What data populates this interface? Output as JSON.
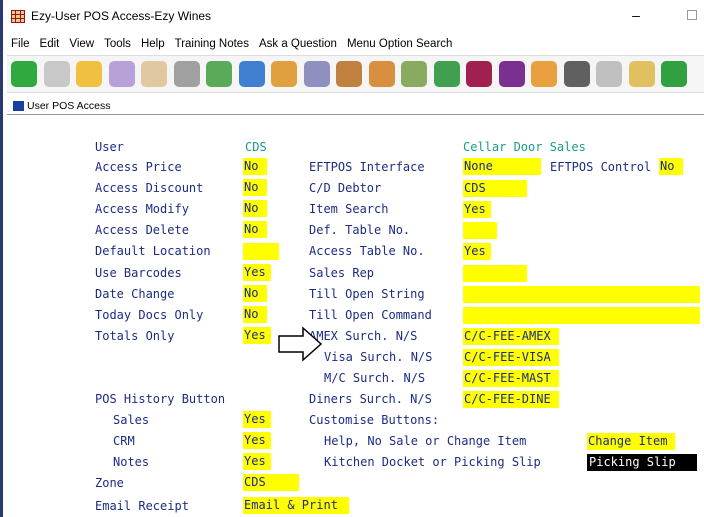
{
  "window": {
    "title": "Ezy-User POS Access-Ezy Wines",
    "minimize": "–"
  },
  "menu": [
    "File",
    "Edit",
    "View",
    "Tools",
    "Help",
    "Training Notes",
    "Ask a Question",
    "Menu Option Search"
  ],
  "toolbar_icons": [
    {
      "name": "back-arrow-icon",
      "color": "#2eaa3e"
    },
    {
      "name": "forward-arrow-icon",
      "color": "#c8c8c8"
    },
    {
      "name": "open-folder-icon",
      "color": "#f0c040"
    },
    {
      "name": "edit-document-icon",
      "color": "#b8a0d8"
    },
    {
      "name": "signature-icon",
      "color": "#e0c8a0"
    },
    {
      "name": "building-icon",
      "color": "#a0a0a0"
    },
    {
      "name": "money-icon",
      "color": "#5aaa5a"
    },
    {
      "name": "screen-icon",
      "color": "#4080d0"
    },
    {
      "name": "users-icon",
      "color": "#e0a040"
    },
    {
      "name": "pen-icon",
      "color": "#9090c0"
    },
    {
      "name": "ball-icon",
      "color": "#c08040"
    },
    {
      "name": "box-icon",
      "color": "#d89040"
    },
    {
      "name": "cup-icon",
      "color": "#8aaa60"
    },
    {
      "name": "chart-icon",
      "color": "#40a050"
    },
    {
      "name": "wine-icon",
      "color": "#a02050"
    },
    {
      "name": "grapes-icon",
      "color": "#7a3090"
    },
    {
      "name": "briefcase-icon",
      "color": "#e8a040"
    },
    {
      "name": "settings-gear-icon",
      "color": "#606060"
    },
    {
      "name": "barrel-icon",
      "color": "#c0c0c0"
    },
    {
      "name": "package-icon",
      "color": "#e0c060"
    },
    {
      "name": "leaf-icon",
      "color": "#30a040"
    }
  ],
  "child_window_title": "User POS Access",
  "form": {
    "user_label": "User",
    "user_value": "CDS",
    "user_name": "Cellar Door Sales",
    "access_price_label": "Access Price",
    "access_price": "No",
    "access_discount_label": "Access Discount",
    "access_discount": "No",
    "access_modify_label": "Access Modify",
    "access_modify": "No",
    "access_delete_label": "Access Delete",
    "access_delete": "No",
    "default_location_label": "Default Location",
    "default_location": "",
    "use_barcodes_label": "Use Barcodes",
    "use_barcodes": "Yes",
    "date_change_label": "Date Change",
    "date_change": "No",
    "today_docs_only_label": "Today Docs Only",
    "today_docs_only": "No",
    "totals_only_label": "Totals Only",
    "totals_only": "Yes",
    "pos_history_label": "POS History Button",
    "sales_label": "Sales",
    "sales": "Yes",
    "crm_label": "CRM",
    "crm": "Yes",
    "notes_label": "Notes",
    "notes": "Yes",
    "zone_label": "Zone",
    "zone": "CDS",
    "email_receipt_label": "Email Receipt",
    "email_receipt": "Email & Print",
    "eftpos_interface_label": "EFTPOS Interface",
    "eftpos_interface": "None",
    "eftpos_control_label": "EFTPOS Control",
    "eftpos_control": "No",
    "cd_debtor_label": "C/D Debtor",
    "cd_debtor": "CDS",
    "item_search_label": "Item Search",
    "item_search": "Yes",
    "def_table_label": "Def. Table No.",
    "def_table": "",
    "access_table_label": "Access Table No.",
    "access_table": "Yes",
    "sales_rep_label": "Sales Rep",
    "sales_rep": "",
    "till_open_string_label": "Till Open String",
    "till_open_string": "",
    "till_open_command_label": "Till Open Command",
    "till_open_command": "",
    "amex_label": "AMEX Surch. N/S",
    "amex": "C/C-FEE-AMEX",
    "visa_label": "Visa Surch. N/S",
    "visa": "C/C-FEE-VISA",
    "mc_label": "M/C Surch. N/S",
    "mc": "C/C-FEE-MAST",
    "diners_label": "Diners Surch. N/S",
    "diners": "C/C-FEE-DINE",
    "customise_label": "Customise Buttons:",
    "help_nosale_label": "Help, No Sale or Change Item",
    "help_nosale": "Change Item",
    "kitchen_label": "Kitchen Docket or Picking Slip",
    "kitchen": "Picking Slip"
  }
}
